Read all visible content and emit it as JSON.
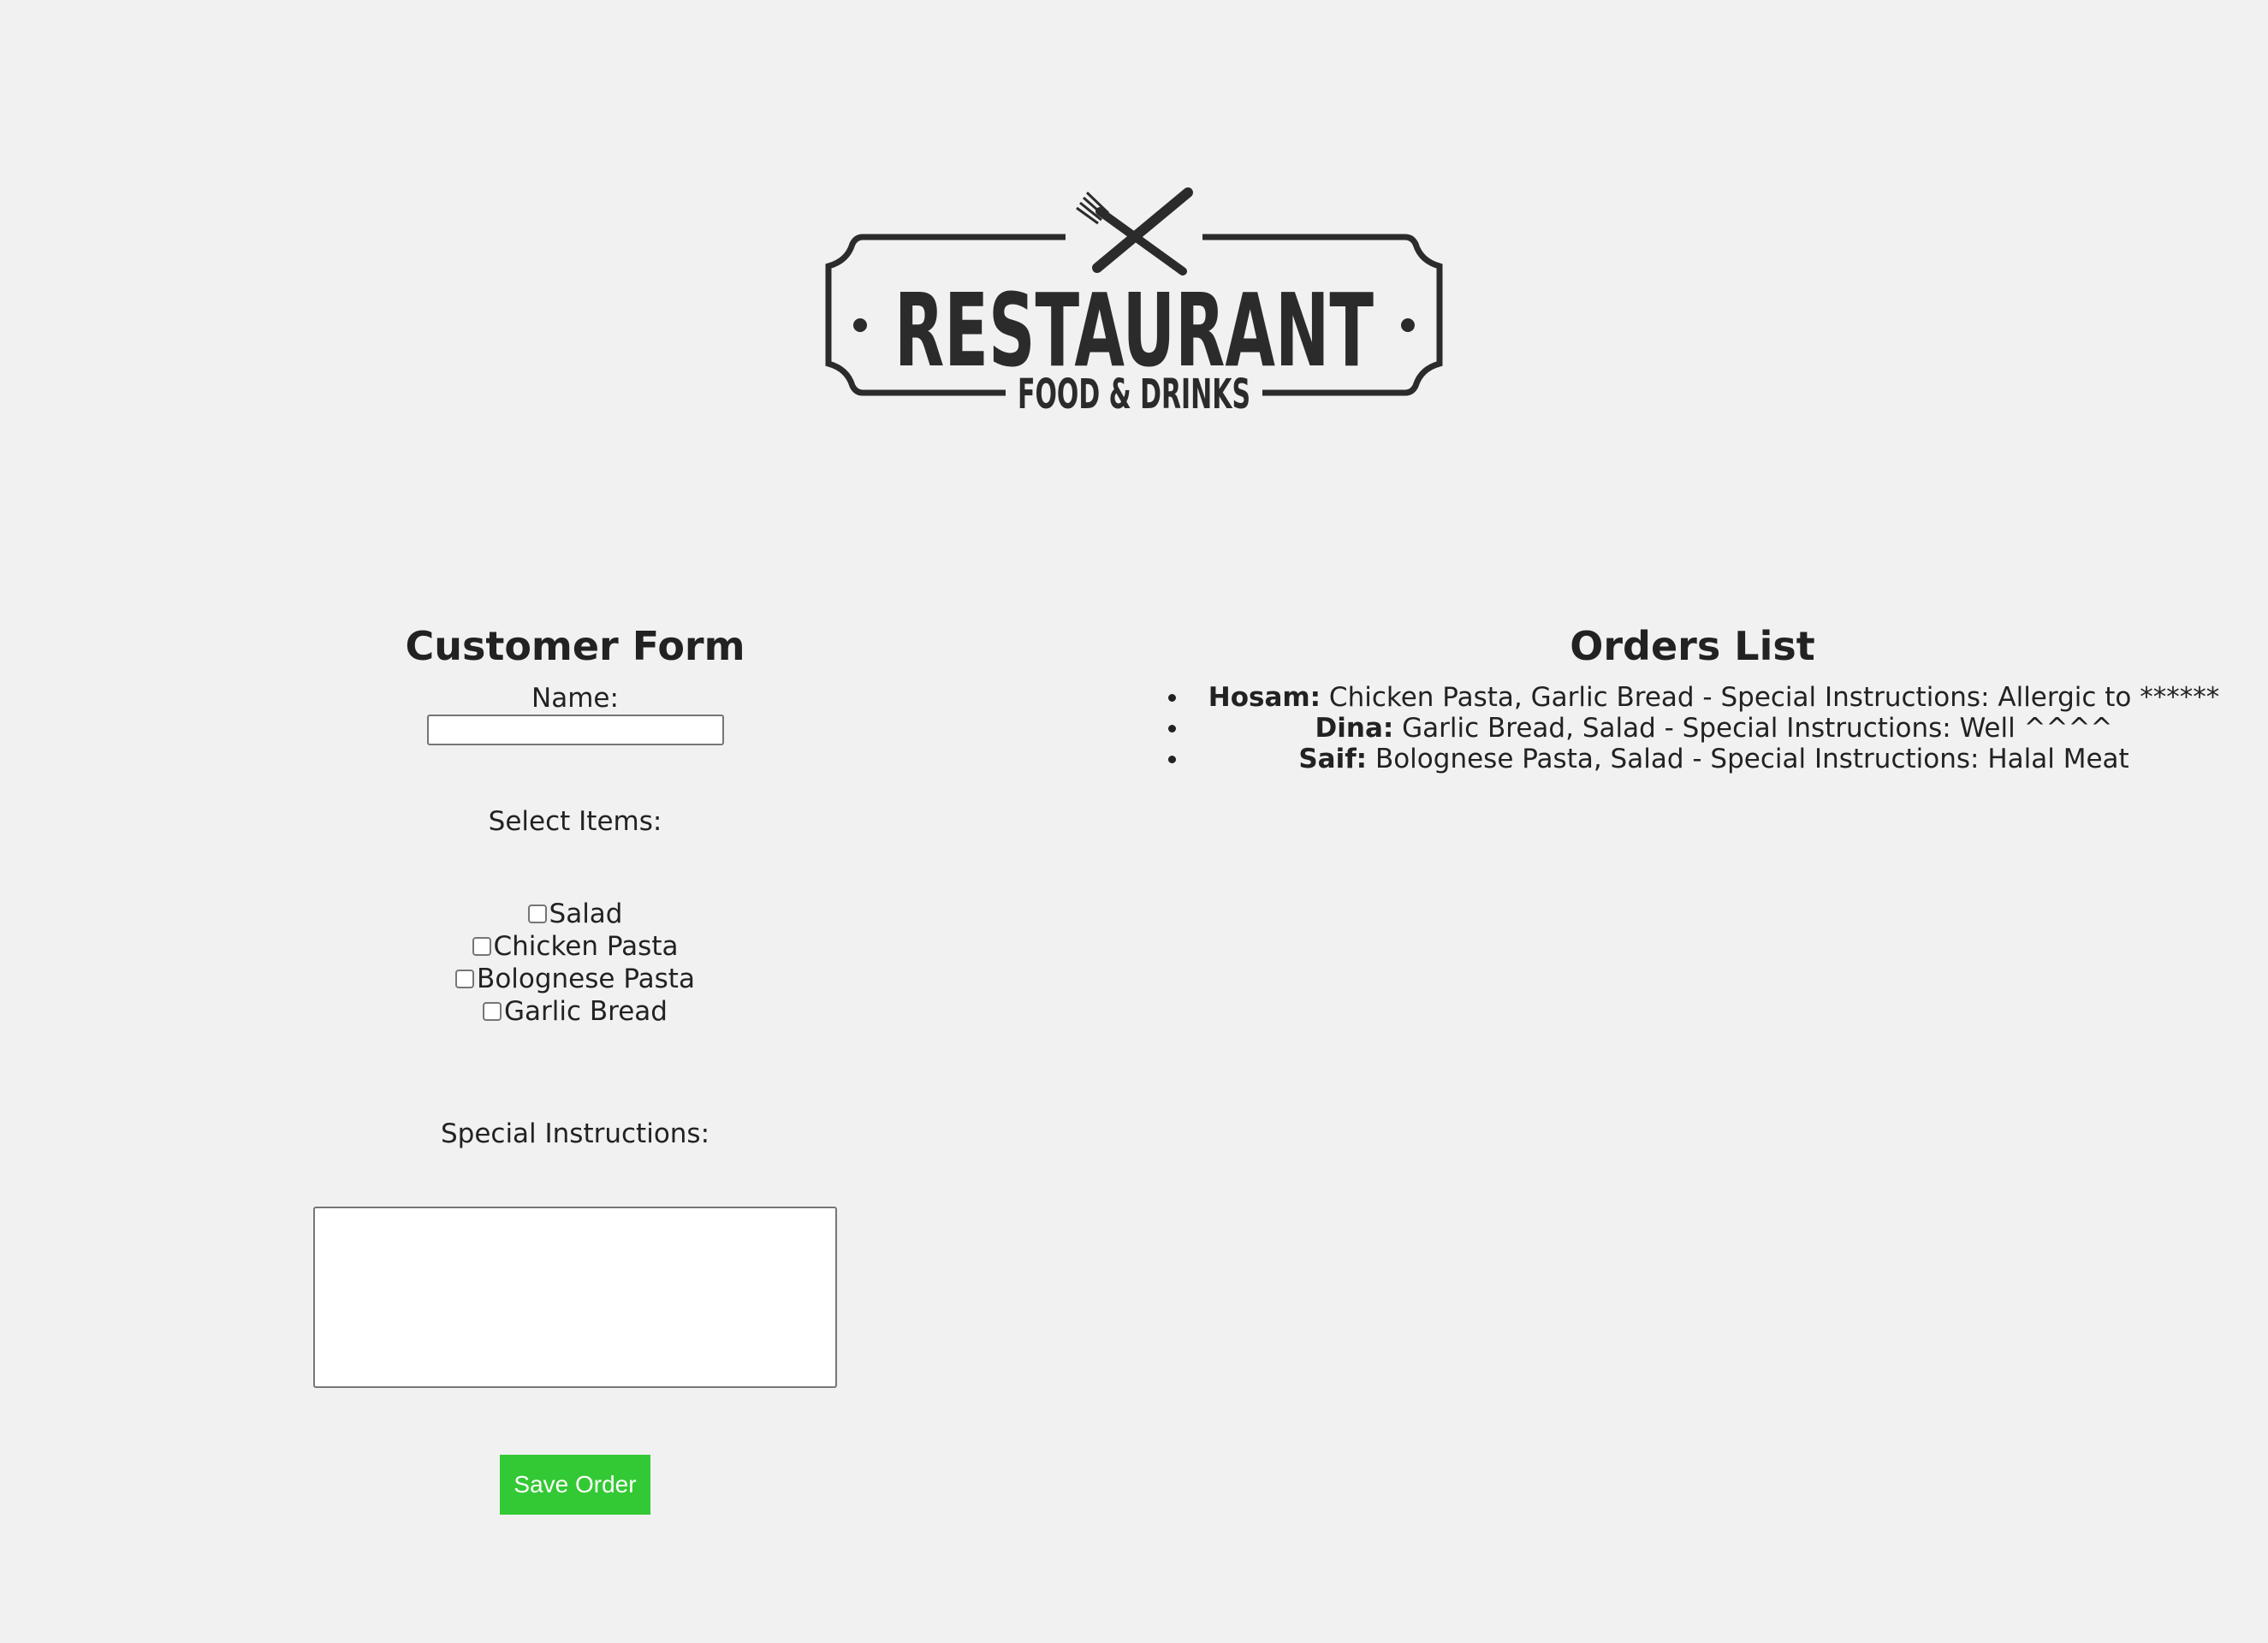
{
  "logo": {
    "title": "RESTAURANT",
    "subtitle": "FOOD & DRINKS"
  },
  "form": {
    "title": "Customer Form",
    "name_label": "Name:",
    "name_value": "",
    "items_label": "Select Items:",
    "items": [
      {
        "label": "Salad",
        "checked": false
      },
      {
        "label": "Chicken Pasta",
        "checked": false
      },
      {
        "label": "Bolognese Pasta",
        "checked": false
      },
      {
        "label": "Garlic Bread",
        "checked": false
      }
    ],
    "instructions_label": "Special Instructions:",
    "instructions_value": "",
    "save_label": "Save Order"
  },
  "orders": {
    "title": "Orders List",
    "items": [
      {
        "name": "Hosam:",
        "detail": "Chicken Pasta, Garlic Bread - Special Instructions: Allergic to ******"
      },
      {
        "name": "Dina:",
        "detail": "Garlic Bread, Salad - Special Instructions: Well ^^^^"
      },
      {
        "name": "Saif:",
        "detail": "Bolognese Pasta, Salad - Special Instructions: Halal Meat"
      }
    ]
  },
  "colors": {
    "background": "#f1f1f1",
    "save_button": "#33c934",
    "text": "#222222",
    "logo": "#2b2b2b"
  }
}
